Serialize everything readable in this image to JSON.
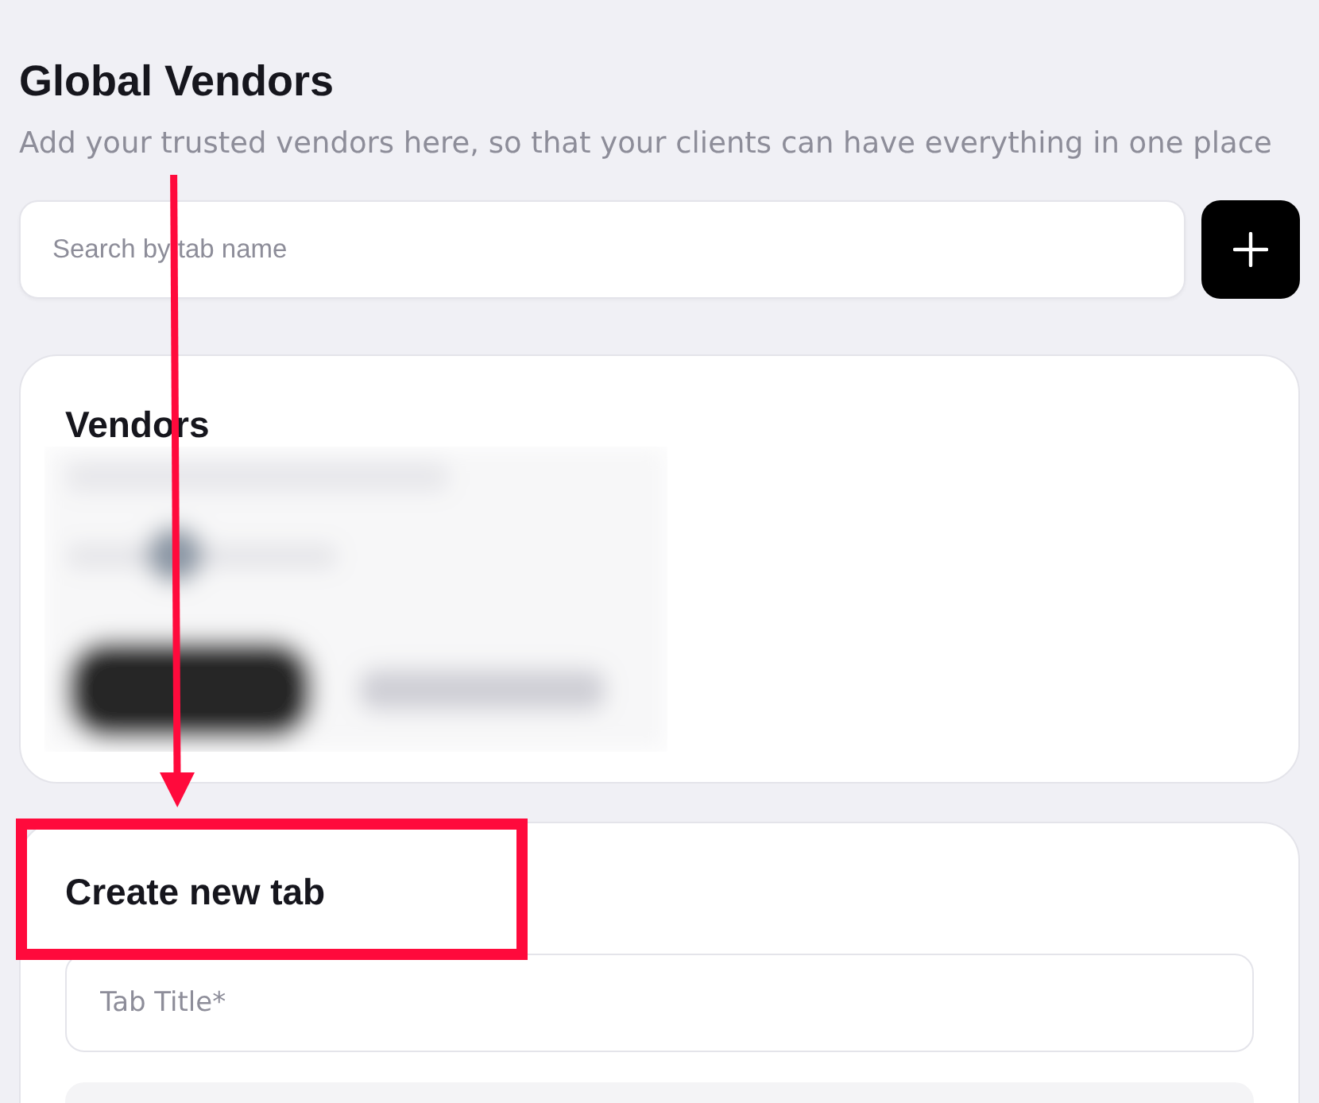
{
  "page": {
    "title": "Global Vendors",
    "subtitle": "Add your trusted vendors here, so that your clients can have everything in one place"
  },
  "search": {
    "placeholder": "Search by tab name"
  },
  "vendors_card": {
    "title": "Vendors",
    "content_blurred": true
  },
  "create_tab_card": {
    "title": "Create new tab",
    "highlighted": true,
    "pointed_by_arrow": true,
    "fields": [
      {
        "kind": "text",
        "placeholder": "Tab Title*"
      },
      {
        "kind": "textarea"
      }
    ]
  }
}
